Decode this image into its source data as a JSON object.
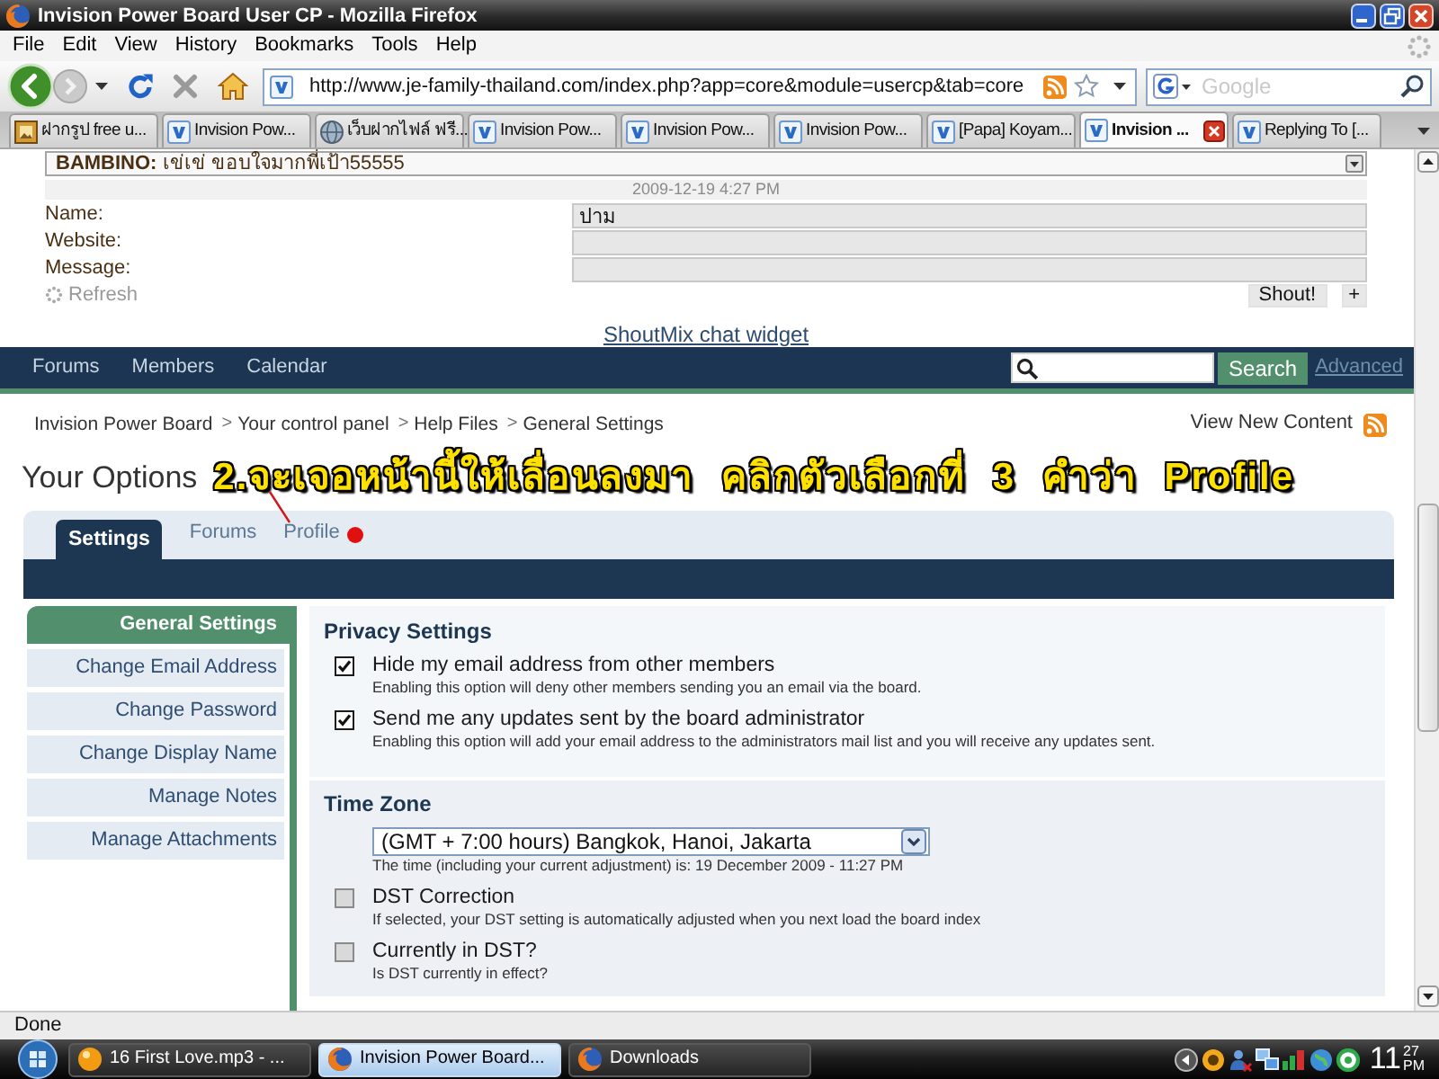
{
  "window": {
    "title": "Invision Power Board User CP - Mozilla Firefox"
  },
  "menu": [
    "File",
    "Edit",
    "View",
    "History",
    "Bookmarks",
    "Tools",
    "Help"
  ],
  "address_bar": {
    "url": "http://www.je-family-thailand.com/index.php?app=core&module=usercp&tab=core"
  },
  "search_bar": {
    "placeholder": "Google"
  },
  "tabs": [
    {
      "label": "ฝากรูป free u...",
      "kind": "picture",
      "selected": false
    },
    {
      "label": "Invision Pow...",
      "kind": "forum",
      "selected": false
    },
    {
      "label": "เว็บฝากไฟล์ ฟรี...",
      "kind": "globe",
      "selected": false
    },
    {
      "label": "Invision Pow...",
      "kind": "forum",
      "selected": false
    },
    {
      "label": "Invision Pow...",
      "kind": "forum",
      "selected": false
    },
    {
      "label": "Invision Pow...",
      "kind": "forum",
      "selected": false
    },
    {
      "label": "[Papa] Koyam...",
      "kind": "forum",
      "selected": false
    },
    {
      "label": "Invision ...",
      "kind": "forum",
      "selected": true
    },
    {
      "label": "Replying To [...",
      "kind": "forum",
      "selected": false
    }
  ],
  "shoutbox": {
    "message": "**BAMBINO:** เข่เข่ ขอบใจมากพี่เป้า55555",
    "timestamp": "2009-12-19 4:27 PM",
    "fields": [
      {
        "label": "Name:",
        "value": "ปาม"
      },
      {
        "label": "Website:"
      },
      {
        "label": "Message:"
      }
    ],
    "refresh": "Refresh",
    "shout_button": "Shout!",
    "add_button": "+",
    "credit_link": "ShoutMix chat widget"
  },
  "forum_nav": {
    "links": [
      "Forums",
      "Members",
      "Calendar"
    ],
    "search_button": "Search",
    "advanced_link": "Advanced"
  },
  "breadcrumb": {
    "separator": ">",
    "items": [
      "Invision Power Board",
      "Your control panel",
      "Help Files",
      "General Settings"
    ],
    "view_new_content": "View New Content"
  },
  "heading": "Your Options",
  "annotation": "2.จะเจอหน้านี้ให้เลื่อนลงมา คลิกตัวเลือกที่ 3 คำว่า Profile",
  "option_tabs": [
    {
      "label": "Settings",
      "selected": true
    },
    {
      "label": "Forums",
      "selected": false
    },
    {
      "label": "Profile",
      "selected": false
    }
  ],
  "sidebar": [
    {
      "label": "General Settings",
      "selected": true
    },
    {
      "label": "Change Email Address",
      "selected": false
    },
    {
      "label": "Change Password",
      "selected": false
    },
    {
      "label": "Change Display Name",
      "selected": false
    },
    {
      "label": "Manage Notes",
      "selected": false
    },
    {
      "label": "Manage Attachments",
      "selected": false
    }
  ],
  "sections": [
    {
      "title": "Privacy Settings",
      "options": [
        {
          "kind": "checkbox",
          "label": "Hide my email address from other members",
          "hint": "Enabling this option will deny other members sending you an email via the board.",
          "checked": true
        },
        {
          "kind": "checkbox",
          "label": "Send me any updates sent by the board administrator",
          "hint": "Enabling this option will add your email address to the administrators mail list and you will receive any updates sent.",
          "checked": true
        }
      ]
    },
    {
      "title": "Time Zone",
      "options": [
        {
          "kind": "select",
          "value": "(GMT + 7:00 hours) Bangkok, Hanoi, Jakarta",
          "hint": "The time (including your current adjustment) is: 19 December 2009 - 11:27 PM"
        },
        {
          "kind": "checkbox",
          "label": "DST Correction",
          "hint": "If selected, your DST setting is automatically adjusted when you next load the board index",
          "checked": false
        },
        {
          "kind": "checkbox",
          "label": "Currently in DST?",
          "hint": "Is DST currently in effect?",
          "checked": false
        }
      ]
    }
  ],
  "status_bar": "Done",
  "taskbar": {
    "tasks": [
      {
        "label": "16 First Love.mp3 - ...",
        "kind": "player",
        "selected": false
      },
      {
        "label": "Invision Power Board...",
        "kind": "browser",
        "selected": true
      },
      {
        "label": "Downloads",
        "kind": "browser",
        "selected": false
      }
    ],
    "clock": {
      "hour": "11",
      "minute": "27",
      "period": "PM"
    }
  }
}
